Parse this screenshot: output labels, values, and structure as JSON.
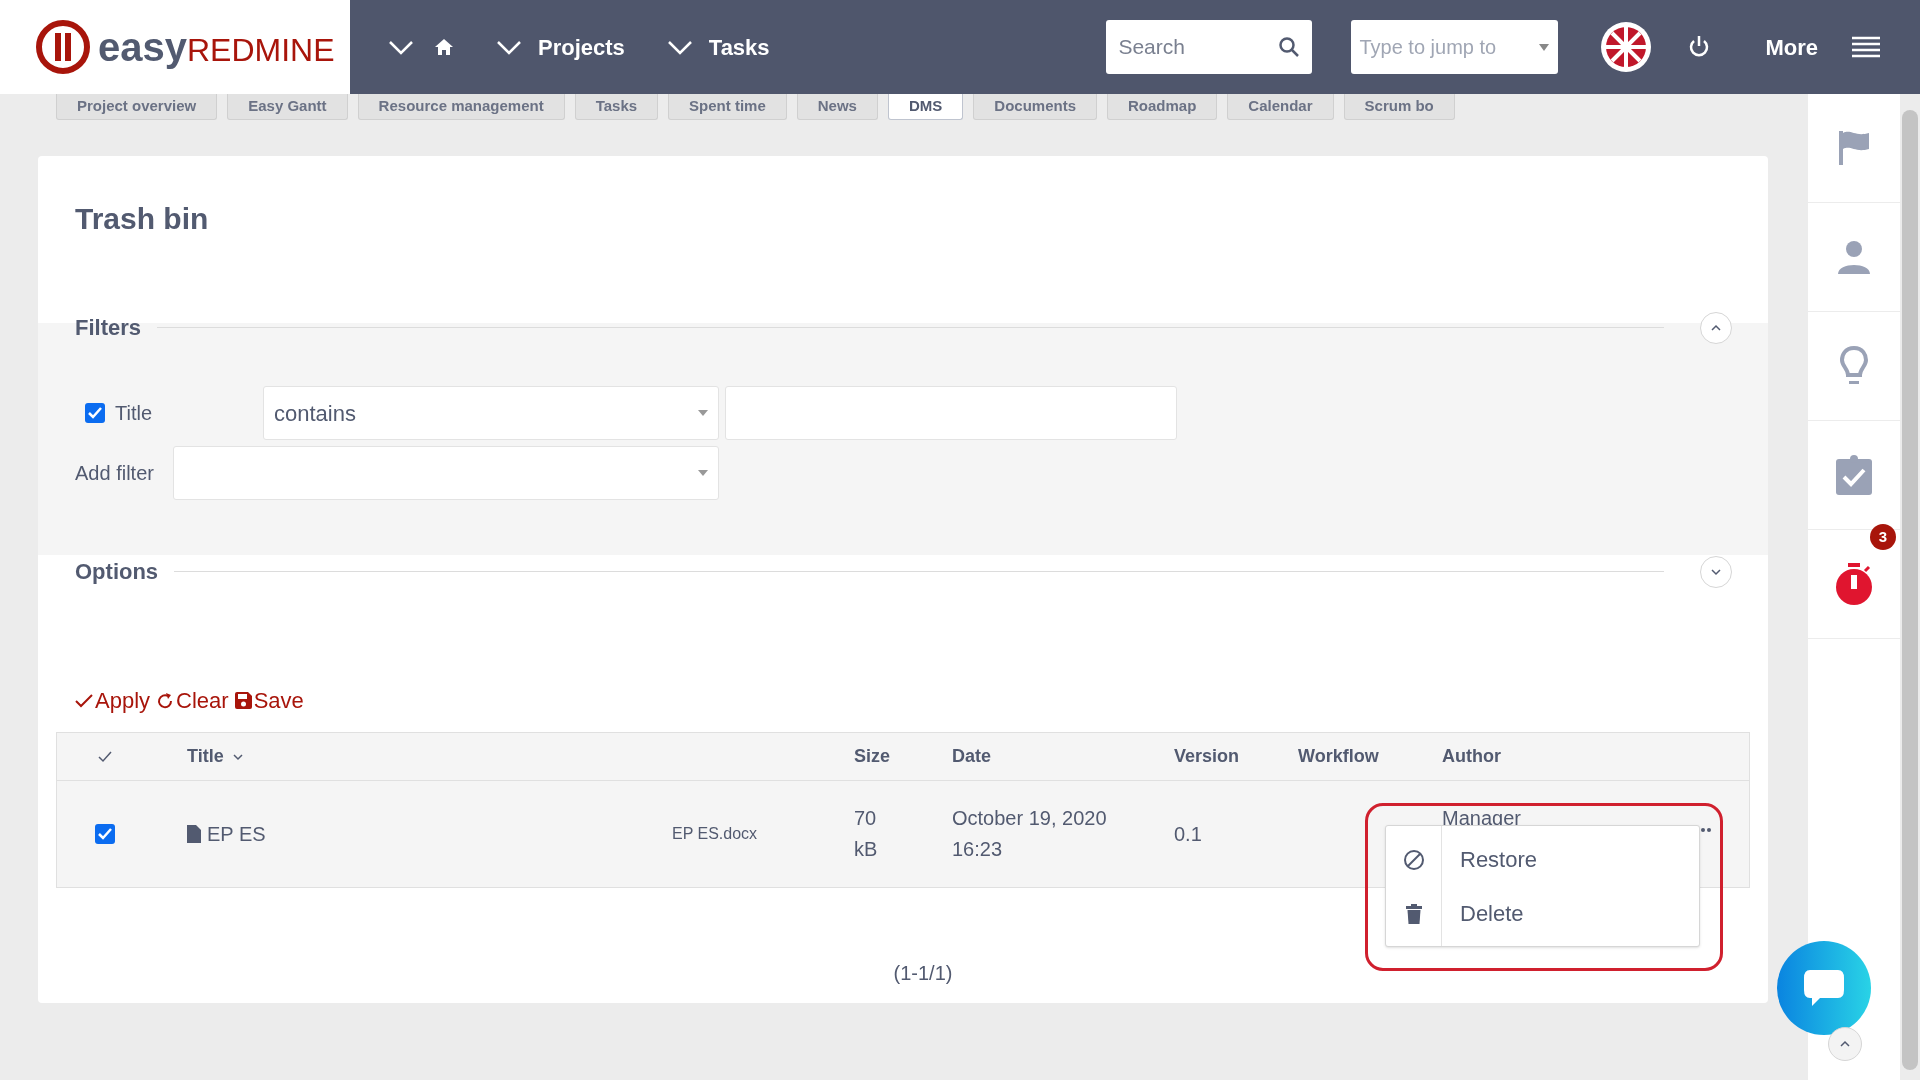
{
  "header": {
    "logo": {
      "part_1": "easy",
      "part_2": "REDMINE"
    },
    "nav": [
      {
        "kind": "home"
      },
      {
        "kind": "link",
        "label": "Projects"
      },
      {
        "kind": "link",
        "label": "Tasks"
      }
    ],
    "search": {
      "placeholder": "Search"
    },
    "jump": {
      "placeholder": "Type to jump to"
    },
    "more": "More"
  },
  "tabs": [
    {
      "label": "Project overview",
      "selected": false
    },
    {
      "label": "Easy Gantt",
      "selected": false
    },
    {
      "label": "Resource management",
      "selected": false
    },
    {
      "label": "Tasks",
      "selected": false
    },
    {
      "label": "Spent time",
      "selected": false
    },
    {
      "label": "News",
      "selected": false
    },
    {
      "label": "DMS",
      "selected": true
    },
    {
      "label": "Documents",
      "selected": false
    },
    {
      "label": "Roadmap",
      "selected": false
    },
    {
      "label": "Calendar",
      "selected": false
    },
    {
      "label": "Scrum bo",
      "selected": false
    }
  ],
  "page": {
    "title": "Trash bin"
  },
  "filters": {
    "heading": "Filters",
    "expanded": true,
    "rows": [
      {
        "label": "Title",
        "checked": true,
        "operator": "contains"
      }
    ],
    "add_filter": "Add filter"
  },
  "options": {
    "heading": "Options",
    "expanded": false
  },
  "actions": [
    {
      "kind": "apply",
      "label": "Apply"
    },
    {
      "kind": "clear",
      "label": "Clear"
    },
    {
      "kind": "save",
      "label": "Save"
    }
  ],
  "table": {
    "columns": [
      "Title",
      "Size",
      "Date",
      "Version",
      "Workflow",
      "Author"
    ],
    "rows": [
      {
        "selected": true,
        "title": "EP ES",
        "filename": "EP ES.docx",
        "size": "70 kB",
        "date": "October 19, 2020 16:23",
        "version": "0.1",
        "author": "Manager"
      }
    ]
  },
  "context_menu": {
    "items": [
      {
        "kind": "restore",
        "label": "Restore"
      },
      {
        "kind": "delete",
        "label": "Delete"
      }
    ]
  },
  "pagination": "(1-1/1)",
  "sidebar": [
    {
      "kind": "flag"
    },
    {
      "kind": "user"
    },
    {
      "kind": "bulb"
    },
    {
      "kind": "clipboard"
    },
    {
      "kind": "timer",
      "badge": "3"
    }
  ]
}
